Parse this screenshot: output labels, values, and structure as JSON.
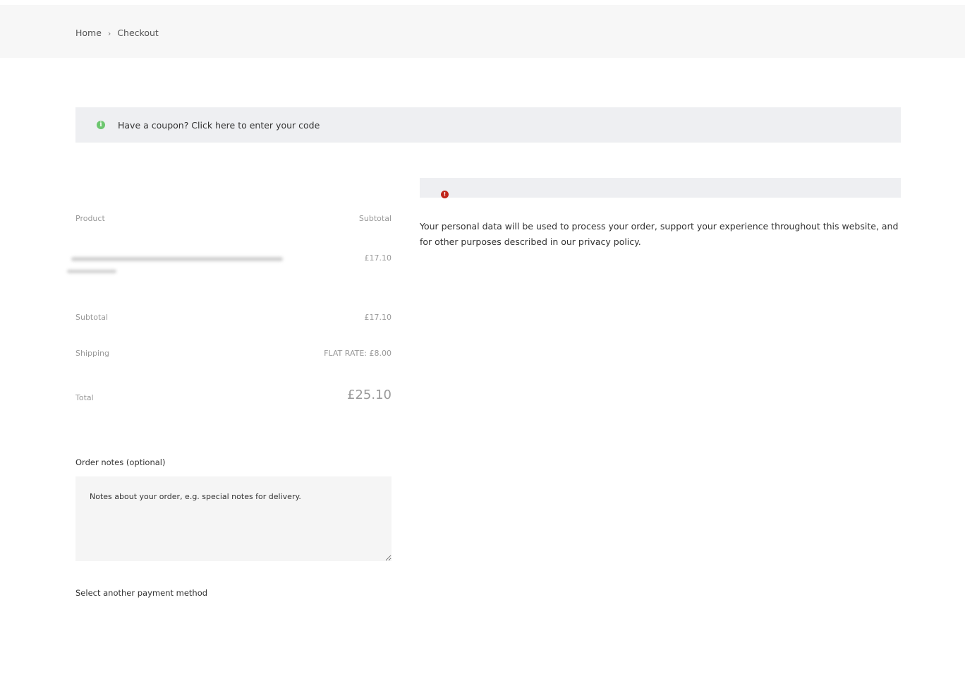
{
  "breadcrumb": {
    "home": "Home",
    "separator": "›",
    "current": "Checkout"
  },
  "coupon": {
    "icon": "info-icon",
    "text": "Have a coupon? Click here to enter your code"
  },
  "order": {
    "header_product": "Product",
    "header_subtotal": "Subtotal",
    "item_price": "£17.10",
    "subtotal_label": "Subtotal",
    "subtotal_value": "£17.10",
    "shipping_label": "Shipping",
    "shipping_value": "FLAT RATE: £8.00",
    "total_label": "Total",
    "total_value": "£25.10"
  },
  "notes": {
    "label": "Order notes (optional)",
    "placeholder": "Notes about your order, e.g. special notes for delivery."
  },
  "payment": {
    "link": "Select another payment method"
  },
  "error": {
    "icon": "error-icon",
    "icon_color": "#c0251a"
  },
  "privacy": {
    "text": "Your personal data will be used to process your order, support your experience throughout this website, and for other purposes described in our privacy policy."
  },
  "colors": {
    "info_green": "#6cc66f",
    "notice_bg": "#eeeff2"
  }
}
